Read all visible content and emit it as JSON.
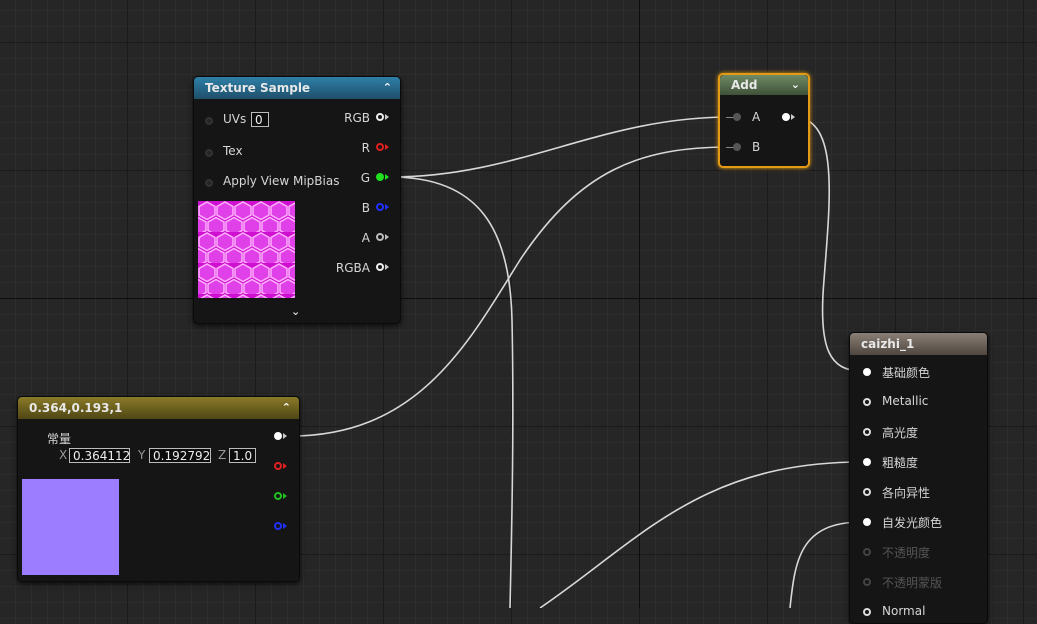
{
  "texture_sample": {
    "title": "Texture Sample",
    "inputs": [
      {
        "label": "UVs",
        "value": "0"
      },
      {
        "label": "Tex"
      },
      {
        "label": "Apply View MipBias"
      }
    ],
    "outputs": [
      "RGB",
      "R",
      "G",
      "B",
      "A",
      "RGBA"
    ],
    "output_colors": [
      "#ffffff",
      "#e02020",
      "#20e020",
      "#2030ff",
      "#bbbbbb",
      "#ffffff"
    ]
  },
  "add_node": {
    "title": "Add",
    "inputs": [
      "A",
      "B"
    ]
  },
  "constant_node": {
    "title": "0.364,0.193,1",
    "label": "常量",
    "x_label": "X",
    "x_value": "0.364112",
    "y_label": "Y",
    "y_value": "0.192792",
    "z_label": "Z",
    "z_value": "1.0",
    "preview_color": "#9d7dff"
  },
  "material_node": {
    "title": "caizhi_1",
    "inputs": [
      {
        "label": "基础颜色",
        "active": true
      },
      {
        "label": "Metallic",
        "active": true
      },
      {
        "label": "高光度",
        "active": true
      },
      {
        "label": "粗糙度",
        "active": true
      },
      {
        "label": "各向异性",
        "active": true
      },
      {
        "label": "自发光颜色",
        "active": true
      },
      {
        "label": "不透明度",
        "active": false
      },
      {
        "label": "不透明蒙版",
        "active": false
      },
      {
        "label": "Normal",
        "active": false
      }
    ]
  }
}
